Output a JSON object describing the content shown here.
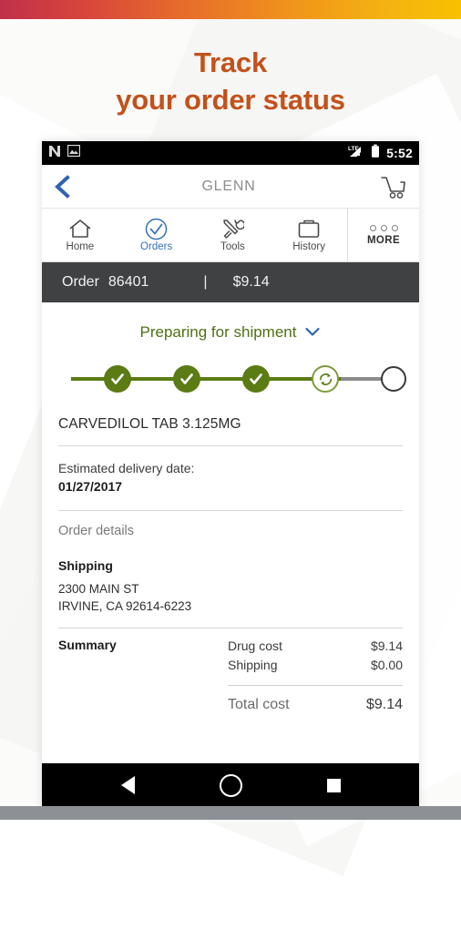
{
  "promo": {
    "heading_line1": "Track",
    "heading_line2": "your order status",
    "accent_color": "#c2511b",
    "gradient_from": "#c0304a",
    "gradient_to": "#f7c000"
  },
  "status_bar": {
    "icons": [
      "n-logo-icon",
      "image-icon"
    ],
    "network_label": "LTE",
    "time": "5:52"
  },
  "app_bar": {
    "back_label": "back-chevron-icon",
    "title": "GLENN",
    "cart_label": "cart-icon"
  },
  "tabs": [
    {
      "label": "Home",
      "icon": "home-icon",
      "active": false
    },
    {
      "label": "Orders",
      "icon": "check-circle-icon",
      "active": true
    },
    {
      "label": "Tools",
      "icon": "tools-icon",
      "active": false
    },
    {
      "label": "History",
      "icon": "briefcase-icon",
      "active": false
    }
  ],
  "more_tab": {
    "label": "MORE",
    "icon": "three-dots-icon"
  },
  "order_bar": {
    "order_word": "Order",
    "order_number": "86401",
    "separator": "|",
    "amount": "$9.14",
    "background": "#3f4143"
  },
  "tracking": {
    "status_text": "Preparing for shipment",
    "status_color": "#4d7012",
    "expand_icon": "chevron-down-icon",
    "steps": [
      {
        "state": "done",
        "icon": "check-icon"
      },
      {
        "state": "done",
        "icon": "check-icon"
      },
      {
        "state": "done",
        "icon": "check-icon"
      },
      {
        "state": "current",
        "icon": "sync-icon"
      },
      {
        "state": "pending",
        "icon": "empty-circle-icon"
      }
    ],
    "done_color": "#5b7b14",
    "pending_color": "#8b8b8b"
  },
  "prescription": {
    "name": "CARVEDILOL TAB 3.125MG"
  },
  "delivery": {
    "label": "Estimated delivery date:",
    "date": "01/27/2017"
  },
  "order_details": {
    "title": "Order details",
    "shipping_heading": "Shipping",
    "address_line1": "2300 MAIN ST",
    "address_line2": "IRVINE, CA 92614-6223"
  },
  "summary": {
    "heading": "Summary",
    "rows": [
      {
        "label": "Drug cost",
        "value": "$9.14"
      },
      {
        "label": "Shipping",
        "value": "$0.00"
      }
    ],
    "total_label": "Total cost",
    "total_value": "$9.14"
  },
  "android_nav": {
    "back": "back-triangle-icon",
    "home": "home-circle-icon",
    "recents": "recents-square-icon"
  }
}
